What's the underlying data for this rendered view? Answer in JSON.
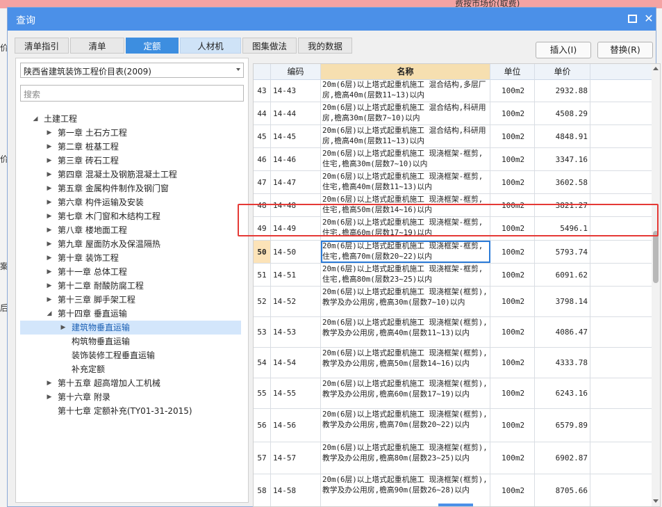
{
  "background": {
    "top_text": "费按市场价(取费)",
    "left_texts": [
      "价",
      "价",
      "案",
      "后"
    ]
  },
  "dialog": {
    "title": "查询"
  },
  "tabs": [
    {
      "label": "清单指引"
    },
    {
      "label": "清单"
    },
    {
      "label": "定额"
    },
    {
      "label": "人材机"
    },
    {
      "label": "图集做法"
    },
    {
      "label": "我的数据"
    }
  ],
  "buttons": {
    "insert": "插入(I)",
    "replace": "替换(R)"
  },
  "left": {
    "library": "陕西省建筑装饰工程价目表(2009)",
    "search_placeholder": "搜索",
    "tree": [
      {
        "label": "土建工程",
        "level": 0,
        "arrow": "open"
      },
      {
        "label": "第一章 土石方工程",
        "level": 1,
        "arrow": "closed"
      },
      {
        "label": "第二章 桩基工程",
        "level": 1,
        "arrow": "closed"
      },
      {
        "label": "第三章 砖石工程",
        "level": 1,
        "arrow": "closed"
      },
      {
        "label": "第四章 混凝土及钢筋混凝土工程",
        "level": 1,
        "arrow": "closed"
      },
      {
        "label": "第五章 金属构件制作及钢门窗",
        "level": 1,
        "arrow": "closed"
      },
      {
        "label": "第六章 构件运输及安装",
        "level": 1,
        "arrow": "closed"
      },
      {
        "label": "第七章 木门窗和木结构工程",
        "level": 1,
        "arrow": "closed"
      },
      {
        "label": "第八章 楼地面工程",
        "level": 1,
        "arrow": "closed"
      },
      {
        "label": "第九章 屋面防水及保温隔热",
        "level": 1,
        "arrow": "closed"
      },
      {
        "label": "第十章 装饰工程",
        "level": 1,
        "arrow": "closed"
      },
      {
        "label": "第十一章 总体工程",
        "level": 1,
        "arrow": "closed"
      },
      {
        "label": "第十二章 耐酸防腐工程",
        "level": 1,
        "arrow": "closed"
      },
      {
        "label": "第十三章 脚手架工程",
        "level": 1,
        "arrow": "closed"
      },
      {
        "label": "第十四章 垂直运输",
        "level": 1,
        "arrow": "open"
      },
      {
        "label": "建筑物垂直运输",
        "level": 2,
        "arrow": "closed",
        "selected": true
      },
      {
        "label": "构筑物垂直运输",
        "level": 2,
        "arrow": "none"
      },
      {
        "label": "装饰装修工程垂直运输",
        "level": 2,
        "arrow": "none"
      },
      {
        "label": "补充定额",
        "level": 2,
        "arrow": "none"
      },
      {
        "label": "第十五章 超高增加人工机械",
        "level": 1,
        "arrow": "closed"
      },
      {
        "label": "第十六章 附录",
        "level": 1,
        "arrow": "closed"
      },
      {
        "label": "第十七章 定额补充(TY01-31-2015)",
        "level": 1,
        "arrow": "none"
      }
    ]
  },
  "table": {
    "headers": {
      "num": "",
      "code": "编码",
      "name": "名称",
      "unit": "单位",
      "price": "单价"
    },
    "rows": [
      {
        "num": "43",
        "code": "14-43",
        "name": "20m(6层)以上塔式起重机施工 混合结构,多层厂房,檐高40m(层数11~13)以内",
        "unit": "100m2",
        "price": "2932.88"
      },
      {
        "num": "44",
        "code": "14-44",
        "name": "20m(6层)以上塔式起重机施工 混合结构,科研用房,檐高30m(层数7~10)以内",
        "unit": "100m2",
        "price": "4508.29"
      },
      {
        "num": "45",
        "code": "14-45",
        "name": "20m(6层)以上塔式起重机施工 混合结构,科研用房,檐高40m(层数11~13)以内",
        "unit": "100m2",
        "price": "4848.91"
      },
      {
        "num": "46",
        "code": "14-46",
        "name": "20m(6层)以上塔式起重机施工 现浇框架-框剪,住宅,檐高30m(层数7~10)以内",
        "unit": "100m2",
        "price": "3347.16"
      },
      {
        "num": "47",
        "code": "14-47",
        "name": "20m(6层)以上塔式起重机施工 现浇框架-框剪,住宅,檐高40m(层数11~13)以内",
        "unit": "100m2",
        "price": "3602.58"
      },
      {
        "num": "48",
        "code": "14-48",
        "name": "20m(6层)以上塔式起重机施工 现浇框架-框剪,住宅,檐高50m(层数14~16)以内",
        "unit": "100m2",
        "price": "3821.27"
      },
      {
        "num": "49",
        "code": "14-49",
        "name": "20m(6层)以上塔式起重机施工 现浇框架-框剪,住宅,檐高60m(层数17~19)以内",
        "unit": "100m2",
        "price": "5496.1"
      },
      {
        "num": "50",
        "code": "14-50",
        "name": "20m(6层)以上塔式起重机施工 现浇框架-框剪,住宅,檐高70m(层数20~22)以内",
        "unit": "100m2",
        "price": "5793.74",
        "current": true
      },
      {
        "num": "51",
        "code": "14-51",
        "name": "20m(6层)以上塔式起重机施工 现浇框架-框剪,住宅,檐高80m(层数23~25)以内",
        "unit": "100m2",
        "price": "6091.62"
      },
      {
        "num": "52",
        "code": "14-52",
        "name": "20m(6层)以上塔式起重机施工 现浇框架(框剪),教学及办公用房,檐高30m(层数7~10)以内",
        "unit": "100m2",
        "price": "3798.14"
      },
      {
        "num": "53",
        "code": "14-53",
        "name": "20m(6层)以上塔式起重机施工 现浇框架(框剪),教学及办公用房,檐高40m(层数11~13)以内",
        "unit": "100m2",
        "price": "4086.47"
      },
      {
        "num": "54",
        "code": "14-54",
        "name": "20m(6层)以上塔式起重机施工 现浇框架(框剪),教学及办公用房,檐高50m(层数14~16)以内",
        "unit": "100m2",
        "price": "4333.78"
      },
      {
        "num": "55",
        "code": "14-55",
        "name": "20m(6层)以上塔式起重机施工 现浇框架(框剪),教学及办公用房,檐高60m(层数17~19)以内",
        "unit": "100m2",
        "price": "6243.16"
      },
      {
        "num": "56",
        "code": "14-56",
        "name": "20m(6层)以上塔式起重机施工 现浇框架(框剪),教学及办公用房,檐高70m(层数20~22)以内",
        "unit": "100m2",
        "price": "6579.89"
      },
      {
        "num": "57",
        "code": "14-57",
        "name": "20m(6层)以上塔式起重机施工 现浇框架(框剪),教学及办公用房,檐高80m(层数23~25)以内",
        "unit": "100m2",
        "price": "6902.87"
      },
      {
        "num": "58",
        "code": "14-58",
        "name": "20m(6层)以上塔式起重机施工 现浇框架(框剪),教学及办公用房,檐高90m(层数26~28)以内",
        "unit": "100m2",
        "price": "8705.66"
      }
    ]
  }
}
